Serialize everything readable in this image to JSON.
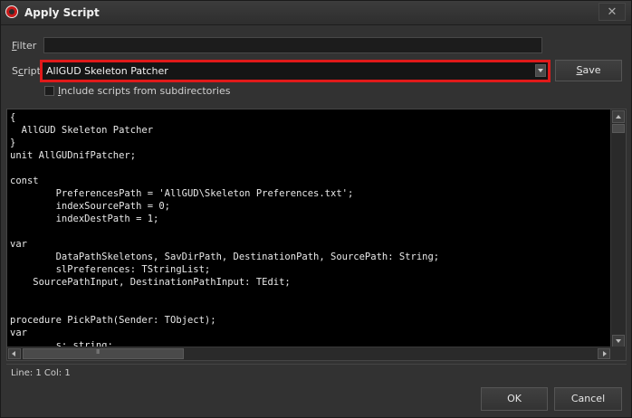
{
  "window": {
    "title": "Apply Script",
    "close_label": "✕"
  },
  "filter": {
    "label_accel": "F",
    "label_rest": "ilter",
    "value": ""
  },
  "script": {
    "label_prefix": "S",
    "label_accel": "c",
    "label_rest": "ript",
    "selected": "AllGUD Skeleton Patcher"
  },
  "save": {
    "label_accel": "S",
    "label_rest": "ave"
  },
  "include_subdirs": {
    "label_accel": "I",
    "label_rest": "nclude scripts from subdirectories",
    "checked": false
  },
  "editor": {
    "code": "{\n  AllGUD Skeleton Patcher\n}\nunit AllGUDnifPatcher;\n\nconst\n        PreferencesPath = 'AllGUD\\Skeleton Preferences.txt';\n        indexSourcePath = 0;\n        indexDestPath = 1;\n\nvar\n        DataPathSkeletons, SavDirPath, DestinationPath, SourcePath: String;\n        slPreferences: TStringList;\n    SourcePathInput, DestinationPathInput: TEdit;\n\n\nprocedure PickPath(Sender: TObject);\nvar\n        s: string;"
  },
  "status": {
    "position": "Line: 1 Col: 1"
  },
  "buttons": {
    "ok": "OK",
    "cancel": "Cancel"
  },
  "colors": {
    "highlight_border": "#e01a1a",
    "background": "#323232",
    "editor_bg": "#000000"
  }
}
